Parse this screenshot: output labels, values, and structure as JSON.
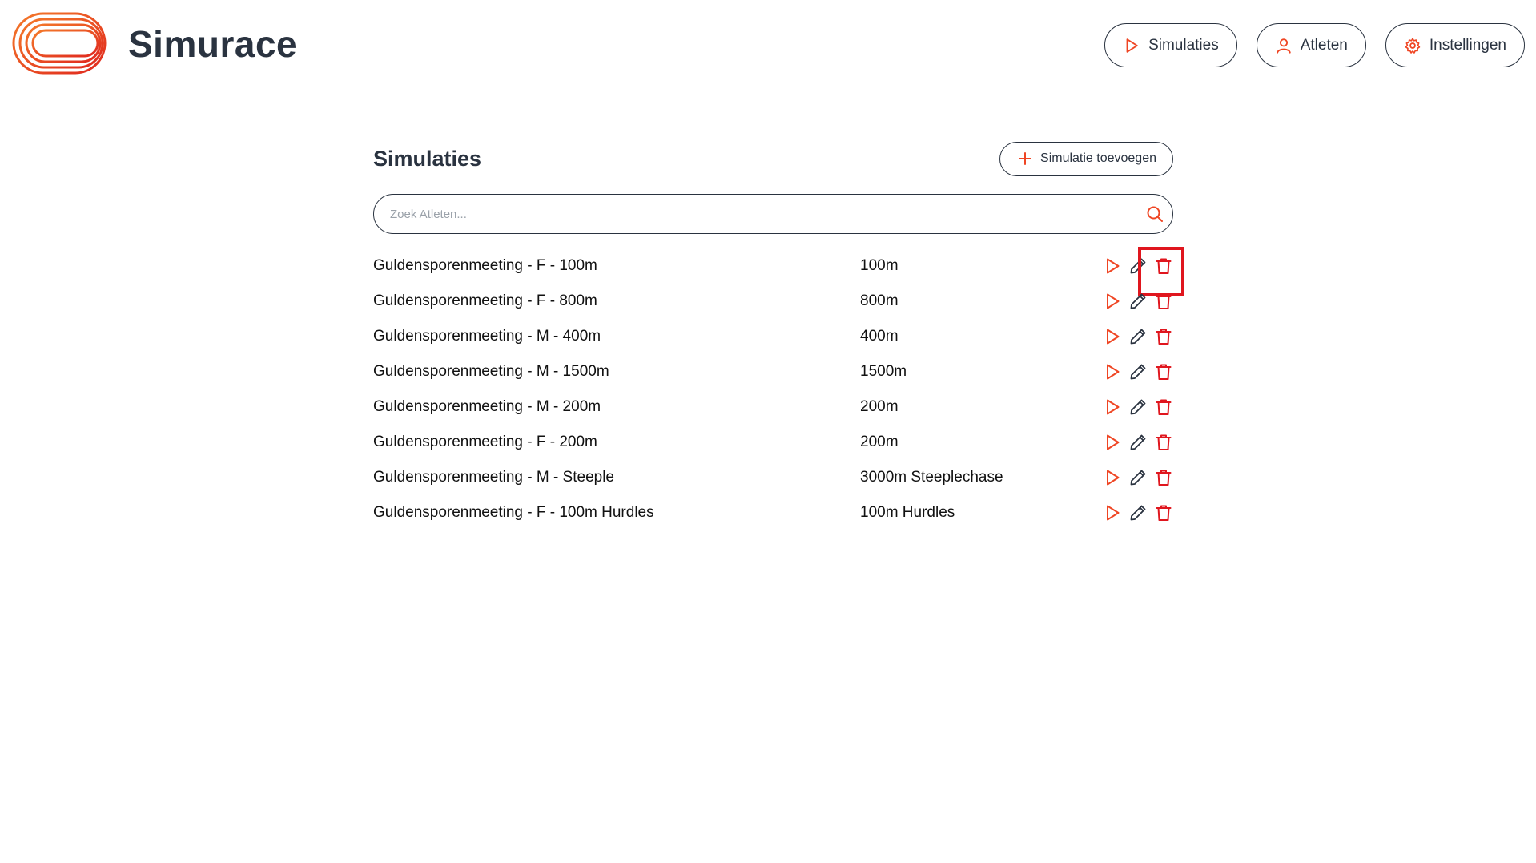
{
  "app": {
    "brand": "Simurace",
    "accent_color": "#ef4523",
    "delete_color": "#e0161e"
  },
  "nav": {
    "items": [
      {
        "label": "Simulaties",
        "icon": "play-icon"
      },
      {
        "label": "Atleten",
        "icon": "user-icon"
      },
      {
        "label": "Instellingen",
        "icon": "gear-icon"
      }
    ]
  },
  "main": {
    "title": "Simulaties",
    "add_button_label": "Simulatie toevoegen",
    "search_placeholder": "Zoek Atleten...",
    "search_value": "",
    "rows": [
      {
        "name": "Guldensporenmeeting - F - 100m",
        "distance": "100m"
      },
      {
        "name": "Guldensporenmeeting - F - 800m",
        "distance": "800m"
      },
      {
        "name": "Guldensporenmeeting - M - 400m",
        "distance": "400m"
      },
      {
        "name": "Guldensporenmeeting - M - 1500m",
        "distance": "1500m"
      },
      {
        "name": "Guldensporenmeeting - M - 200m",
        "distance": "200m"
      },
      {
        "name": "Guldensporenmeeting - F - 200m",
        "distance": "200m"
      },
      {
        "name": "Guldensporenmeeting - M - Steeple",
        "distance": "3000m Steeplechase"
      },
      {
        "name": "Guldensporenmeeting - F - 100m Hurdles",
        "distance": "100m Hurdles"
      }
    ]
  }
}
